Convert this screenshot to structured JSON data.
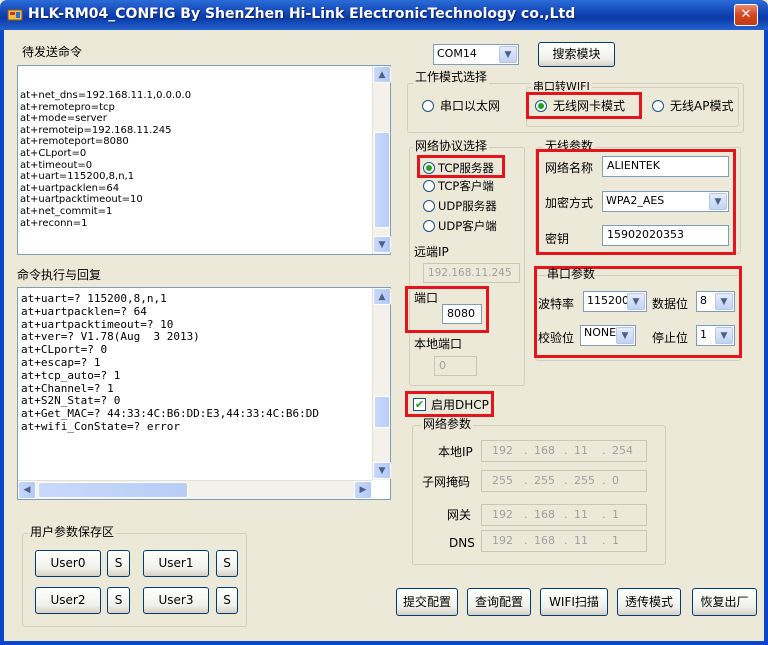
{
  "window": {
    "title": "HLK-RM04_CONFIG By ShenZhen Hi-Link ElectronicTechnology co.,Ltd",
    "close_label": "✕"
  },
  "send_panel": {
    "label": "待发送命令",
    "lines": [
      "at+net_dns=192.168.11.1,0.0.0.0",
      "at+remotepro=tcp",
      "at+mode=server",
      "at+remoteip=192.168.11.245",
      "at+remoteport=8080",
      "at+CLport=0",
      "at+timeout=0",
      "at+uart=115200,8,n,1",
      "at+uartpacklen=64",
      "at+uartpacktimeout=10",
      "at+net_commit=1",
      "at+reconn=1"
    ]
  },
  "reply_panel": {
    "label": "命令执行与回复",
    "lines": [
      "at+uart=? 115200,8,n,1",
      "at+uartpacklen=? 64",
      "at+uartpacktimeout=? 10",
      "at+ver=? V1.78(Aug  3 2013)",
      "at+CLport=? 0",
      "at+escap=? 1",
      "at+tcp_auto=? 1",
      "at+Channel=? 1",
      "at+S2N_Stat=? 0",
      "at+Get_MAC=? 44:33:4C:B6:DD:E3,44:33:4C:B6:DD",
      "at+wifi_ConState=? error"
    ]
  },
  "user_params": {
    "label": "用户参数保存区",
    "buttons": [
      "User0",
      "User1",
      "User2",
      "User3"
    ],
    "save_label": "S"
  },
  "com": {
    "port": "COM14",
    "search_button": "搜索模块"
  },
  "work_mode": {
    "label": "工作模式选择",
    "ethernet_option": "串口以太网",
    "wifi_group_label": "串口转WIFI",
    "wifi_nic_option": "无线网卡模式",
    "wifi_ap_option": "无线AP模式",
    "selected": "无线网卡模式"
  },
  "protocol": {
    "label": "网络协议选择",
    "options": [
      "TCP服务器",
      "TCP客户端",
      "UDP服务器",
      "UDP客户端"
    ],
    "selected": "TCP服务器",
    "remote_ip_label": "远端IP",
    "remote_ip": "192.168.11.245",
    "port_label": "端口",
    "port": "8080",
    "local_port_label": "本地端口",
    "local_port": "0"
  },
  "wireless": {
    "label": "无线参数",
    "ssid_label": "网络名称",
    "ssid": "ALIENTEK",
    "encryption_label": "加密方式",
    "encryption": "WPA2_AES",
    "key_label": "密钥",
    "key": "15902020353"
  },
  "serial": {
    "label": "串口参数",
    "baud_label": "波特率",
    "baud": "115200",
    "databits_label": "数据位",
    "databits": "8",
    "parity_label": "校验位",
    "parity": "NONE",
    "stopbits_label": "停止位",
    "stopbits": "1"
  },
  "dhcp": {
    "label": "启用DHCP",
    "checked": true
  },
  "network": {
    "label": "网络参数",
    "ip_label": "本地IP",
    "ip": [
      "192",
      "168",
      "11",
      "254"
    ],
    "mask_label": "子网掩码",
    "mask": [
      "255",
      "255",
      "255",
      "0"
    ],
    "gateway_label": "网关",
    "gateway": [
      "192",
      "168",
      "11",
      "1"
    ],
    "dns_label": "DNS",
    "dns": [
      "192",
      "168",
      "11",
      "1"
    ]
  },
  "actions": {
    "submit": "提交配置",
    "query": "查询配置",
    "wifi_scan": "WIFI扫描",
    "transparent": "透传模式",
    "restore": "恢复出厂"
  },
  "colors": {
    "highlight": "#e3141b",
    "titlebar": "#1547b8",
    "radio_dot": "#21a121"
  }
}
